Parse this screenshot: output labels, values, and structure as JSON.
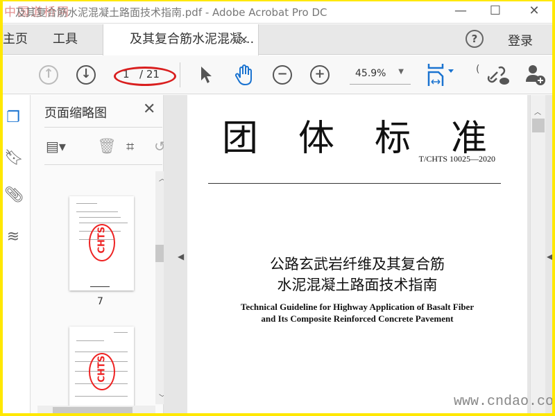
{
  "window": {
    "title": "及其复合筋水泥混凝土路面技术指南.pdf - Adobe Acrobat Pro DC",
    "watermark_logo": "中国道桥网",
    "minimize": "—",
    "maximize": "☐",
    "close": "✕"
  },
  "tabs": {
    "home": "主页",
    "tools": "工具",
    "document": "及其复合筋水泥混凝...",
    "close": "×",
    "help": "?",
    "login": "登录"
  },
  "toolbar": {
    "current_page": "1",
    "total_pages": "/ 21",
    "zoom": "45.9%",
    "annotation_color": "#d91e1e"
  },
  "sidebar": {
    "title": "页面缩略图",
    "close": "✕",
    "thumbnails": [
      {
        "label": "7",
        "stamp": "CHTS"
      },
      {
        "label": "",
        "stamp": "CHTS"
      }
    ]
  },
  "document": {
    "heading": "团体标准",
    "code": "T/CHTS 10025—2020",
    "title_zh_1": "公路玄武岩纤维及其复合筋",
    "title_zh_2": "水泥混凝土路面技术指南",
    "title_en_1": "Technical Guideline for Highway Application of Basalt Fiber",
    "title_en_2": "and Its Composite Reinforced Concrete Pavement"
  },
  "watermark": "www.cndao.com"
}
